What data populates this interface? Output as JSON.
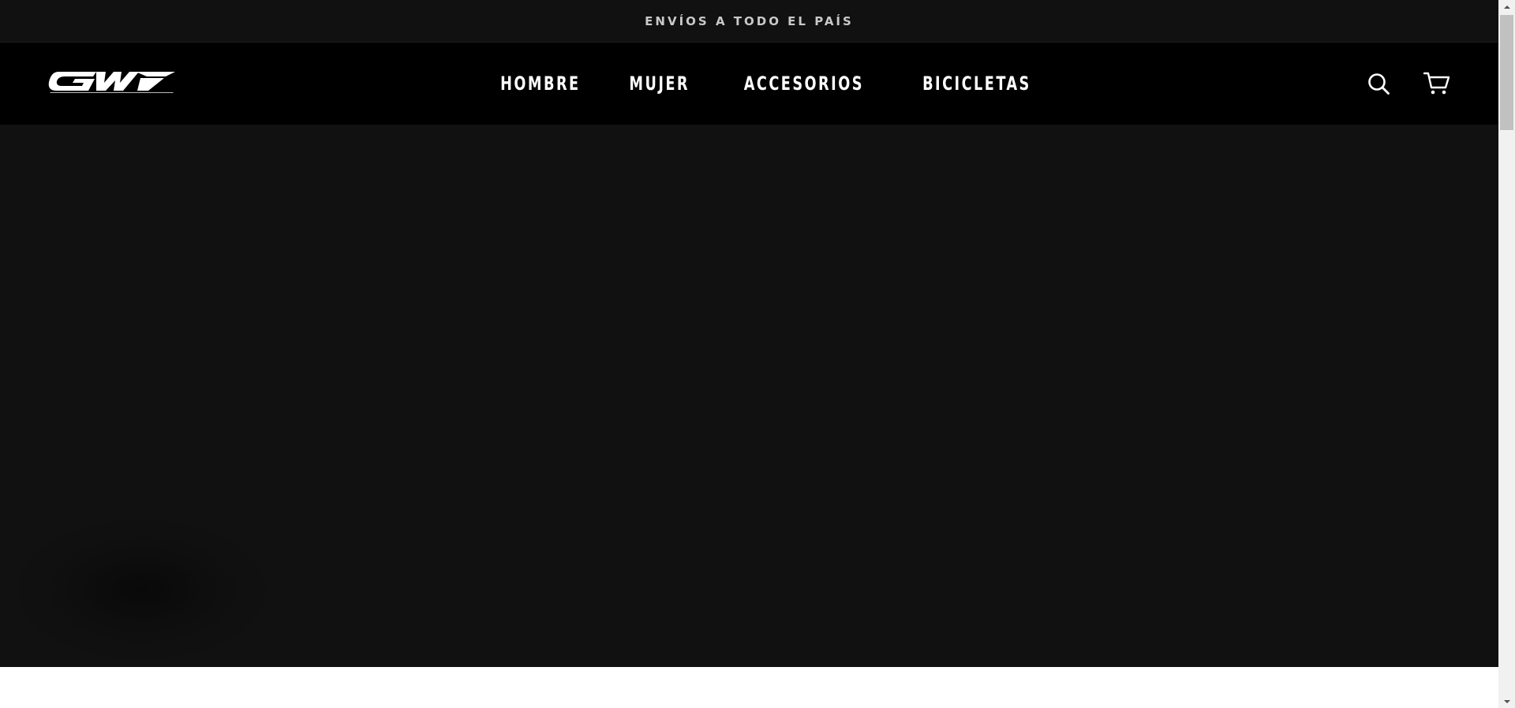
{
  "announcement": {
    "text": "ENVÍOS A TODO EL PAÍS"
  },
  "header": {
    "logo": {
      "brand_text": "GW",
      "tagline": "made for WINNERS"
    },
    "nav": [
      {
        "label": "HOMBRE"
      },
      {
        "label": "MUJER"
      },
      {
        "label": "ACCESORIOS"
      },
      {
        "label": "BICICLETAS"
      }
    ],
    "icons": {
      "search": "search-icon",
      "cart": "cart-icon"
    }
  },
  "colors": {
    "announcement_bg": "#111111",
    "header_bg": "#000000",
    "hero_bg": "#111111",
    "nav_text": "#ffffff",
    "announcement_text": "#c9c9c9"
  }
}
